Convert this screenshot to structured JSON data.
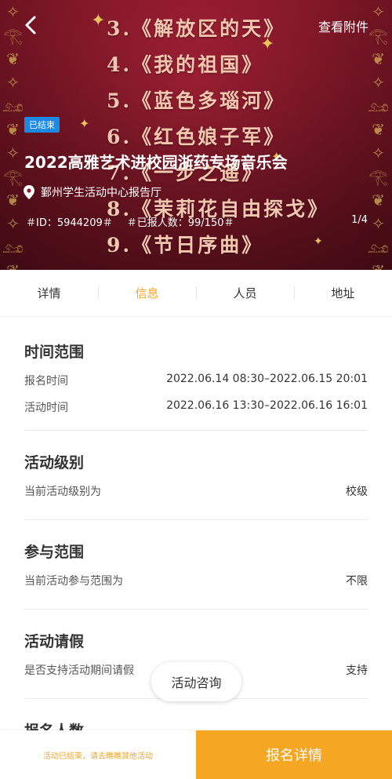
{
  "header": {
    "attachments_label": "查看附件",
    "status_badge": "已结束",
    "title": "2022高雅艺术进校园浙药专场音乐会",
    "location": "鄞州学生活动中心报告厅",
    "id_text": "＃ID：5944209＃",
    "signup_count_text": "＃已报人数：99/150＃",
    "pager": "1/4",
    "poster_lines": [
      "3.《解放区的天》",
      "4.《我的祖国》",
      "5.《蓝色多瑙河》",
      "6.《红色娘子军》",
      "7.《一步之遥》",
      "8.《茉莉花自由探戈》",
      "9.《节日序曲》"
    ]
  },
  "tabs": [
    {
      "label": "详情",
      "active": false
    },
    {
      "label": "信息",
      "active": true
    },
    {
      "label": "人员",
      "active": false
    },
    {
      "label": "地址",
      "active": false
    }
  ],
  "sections": {
    "time": {
      "title": "时间范围",
      "signup_label": "报名时间",
      "signup_value": "2022.06.14 08:30–2022.06.15 20:01",
      "activity_label": "活动时间",
      "activity_value": "2022.06.16 13:30–2022.06.16 16:01"
    },
    "level": {
      "title": "活动级别",
      "label": "当前活动级别为",
      "value": "校级"
    },
    "scope": {
      "title": "参与范围",
      "label": "当前活动参与范围为",
      "value": "不限"
    },
    "leave": {
      "title": "活动请假",
      "label": "是否支持活动期间请假",
      "value": "支持"
    },
    "count": {
      "title": "报名人数"
    }
  },
  "consult_button": "活动咨询",
  "bottom": {
    "ended_note": "活动已结束，请去瞧瞧其他活动",
    "register_detail": "报名详情"
  },
  "colors": {
    "accent": "#f5a623",
    "badge_blue": "#1e88e5",
    "banner_red": "#8e1a2c"
  },
  "icons": [
    "back-arrow-icon",
    "location-pin-icon"
  ]
}
